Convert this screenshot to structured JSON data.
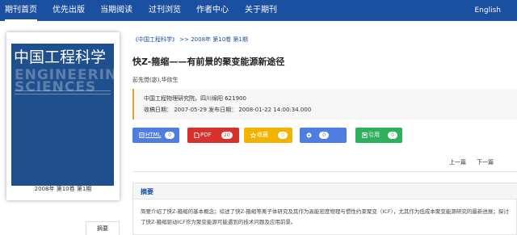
{
  "nav": {
    "items": [
      "期刊首页",
      "优先出版",
      "当期阅读",
      "过刊浏览",
      "作者中心",
      "关于期刊"
    ],
    "lang": "English"
  },
  "cover": {
    "title": "中国工程科学",
    "english_lines": [
      "ENGINEERING",
      "SCIENCES"
    ],
    "caption": "2008年 第10卷 第1期"
  },
  "left_tab": "摘要",
  "breadcrumb": {
    "journal": "《中国工程科学》",
    "sep": ">>",
    "issue": "2008年 第10卷 第1期"
  },
  "article": {
    "title": "快Z-箍缩——有前景的聚变能源新途径",
    "authors": "彭先觉(宓),华欣生",
    "org": "中国工程物理研究院，四川绵阳 621900",
    "dates": "收稿日期： 2007-05-29   发布日期： 2008-01-22 14:00:34.000"
  },
  "actions": [
    {
      "label": "HTML",
      "count": "0",
      "color": "#4e7ee0",
      "icon": "document-icon"
    },
    {
      "label": "PDF",
      "count": "20",
      "color": "#d9312b",
      "icon": "pdf-icon"
    },
    {
      "label": "收藏",
      "count": "0",
      "color": "#f0b400",
      "icon": "star-icon"
    },
    {
      "label": "",
      "count": "0",
      "color": "#4e7ee0",
      "icon": "share-icon"
    },
    {
      "label": "引用",
      "count": "0",
      "color": "#2fb05c",
      "icon": "quote-icon"
    }
  ],
  "pager": {
    "prev": "上一篇",
    "next": "下一篇"
  },
  "abstract": {
    "heading": "摘要",
    "text": "简要介绍了快Z-箍缩的基本概念；综述了快Z-箍缩等离子体研究及其作为高能密度物理与惯性约束聚变（ICF），尤其作为低成本聚变能源研究的最新进展；探讨了快Z-箍缩驱动ICF作为聚变能源可能遇到的技术问题及应用前景。"
  }
}
